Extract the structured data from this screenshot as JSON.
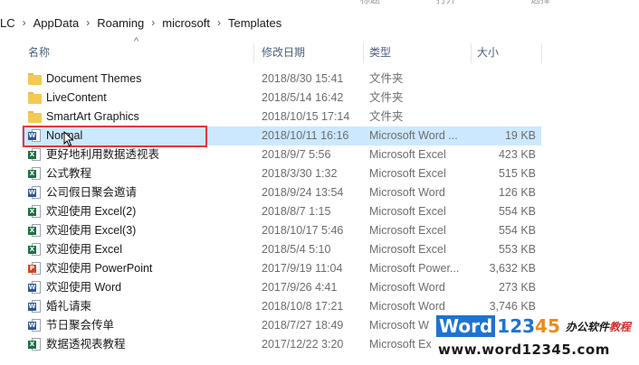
{
  "top_strip": {
    "item1": "标题",
    "item2": "打开",
    "item3": "选择"
  },
  "breadcrumb": [
    "LC",
    "AppData",
    "Roaming",
    "microsoft",
    "Templates"
  ],
  "columns": {
    "name": "名称",
    "date": "修改日期",
    "type": "类型",
    "size": "大小"
  },
  "files": [
    {
      "name": "Document Themes",
      "date": "2018/8/30 15:41",
      "type": "文件夹",
      "size": "",
      "icon": "folder-icon"
    },
    {
      "name": "LiveContent",
      "date": "2018/5/14 16:42",
      "type": "文件夹",
      "size": "",
      "icon": "folder-icon"
    },
    {
      "name": "SmartArt Graphics",
      "date": "2018/10/15 17:14",
      "type": "文件夹",
      "size": "",
      "icon": "folder-icon"
    },
    {
      "name": "Normal",
      "date": "2018/10/11 16:16",
      "type": "Microsoft Word ...",
      "size": "19 KB",
      "icon": "word-icon"
    },
    {
      "name": "更好地利用数据透视表",
      "date": "2018/9/7 5:56",
      "type": "Microsoft Excel",
      "size": "423 KB",
      "icon": "excel-icon"
    },
    {
      "name": "公式教程",
      "date": "2018/3/30 1:32",
      "type": "Microsoft Excel",
      "size": "515 KB",
      "icon": "excel-icon"
    },
    {
      "name": "公司假日聚会邀请",
      "date": "2018/9/24 13:54",
      "type": "Microsoft Word",
      "size": "126 KB",
      "icon": "word-icon"
    },
    {
      "name": "欢迎使用 Excel(2)",
      "date": "2018/8/7 1:15",
      "type": "Microsoft Excel",
      "size": "554 KB",
      "icon": "excel-icon"
    },
    {
      "name": "欢迎使用 Excel(3)",
      "date": "2018/10/17 5:46",
      "type": "Microsoft Excel",
      "size": "554 KB",
      "icon": "excel-icon"
    },
    {
      "name": "欢迎使用 Excel",
      "date": "2018/5/4 5:10",
      "type": "Microsoft Excel",
      "size": "553 KB",
      "icon": "excel-icon"
    },
    {
      "name": "欢迎使用 PowerPoint",
      "date": "2017/9/19 11:04",
      "type": "Microsoft Power...",
      "size": "3,632 KB",
      "icon": "powerpoint-icon"
    },
    {
      "name": "欢迎使用 Word",
      "date": "2017/9/26 4:41",
      "type": "Microsoft Word",
      "size": "273 KB",
      "icon": "word-icon"
    },
    {
      "name": "婚礼请柬",
      "date": "2018/10/8 17:21",
      "type": "Microsoft Word",
      "size": "3,746 KB",
      "icon": "word-icon"
    },
    {
      "name": "节日聚会传单",
      "date": "2018/7/27 18:49",
      "type": "Microsoft W",
      "size": "",
      "icon": "word-icon"
    },
    {
      "name": "数据透视表教程",
      "date": "2017/12/22 3:20",
      "type": "Microsoft Ex",
      "size": "",
      "icon": "excel-icon"
    }
  ],
  "selected_index": 3,
  "watermark": {
    "brand": "Word",
    "num1": "123",
    "num2": "45",
    "tagline_a": "办公软件",
    "tagline_b": "教程",
    "url": "www.word12345.com"
  },
  "colors": {
    "selection": "#cce8ff",
    "highlight_border": "#e53935",
    "folder": "#f3c954",
    "word": "#2b5797",
    "excel": "#1e7145",
    "powerpoint": "#d24726"
  }
}
